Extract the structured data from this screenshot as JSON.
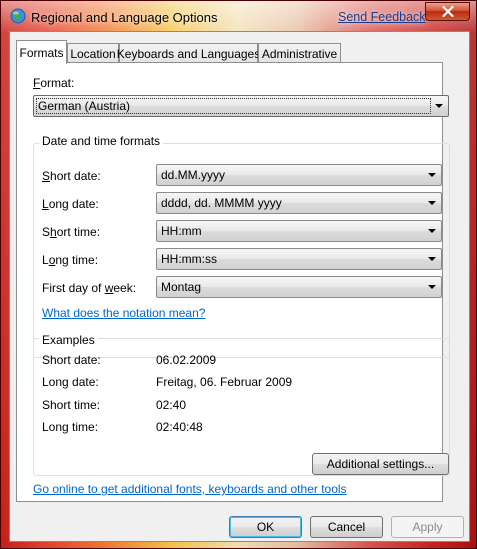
{
  "window": {
    "title": "Regional and Language Options",
    "send_feedback": "Send Feedback",
    "close_icon": "close-icon"
  },
  "tabs": [
    {
      "label": "Formats",
      "active": true
    },
    {
      "label": "Location",
      "active": false
    },
    {
      "label": "Keyboards and Languages",
      "active": false
    },
    {
      "label": "Administrative",
      "active": false
    }
  ],
  "format": {
    "label": "Format:",
    "value": "German (Austria)"
  },
  "date_time": {
    "group_title": "Date and time formats",
    "short_date": {
      "label": "Short date:",
      "value": "dd.MM.yyyy"
    },
    "long_date": {
      "label": "Long date:",
      "value": "dddd, dd. MMMM yyyy"
    },
    "short_time": {
      "label": "Short time:",
      "value": "HH:mm"
    },
    "long_time": {
      "label": "Long time:",
      "value": "HH:mm:ss"
    },
    "first_day": {
      "label": "First day of week:",
      "value": "Montag"
    },
    "notation_link": "What does the notation mean?"
  },
  "examples": {
    "group_title": "Examples",
    "rows": [
      {
        "label": "Short date:",
        "value": "06.02.2009"
      },
      {
        "label": "Long date:",
        "value": "Freitag, 06. Februar 2009"
      },
      {
        "label": "Short time:",
        "value": "02:40"
      },
      {
        "label": "Long time:",
        "value": "02:40:48"
      }
    ]
  },
  "additional_settings": "Additional settings...",
  "online_link": "Go online to get additional fonts, keyboards and other tools",
  "buttons": {
    "ok": "OK",
    "cancel": "Cancel",
    "apply": "Apply"
  }
}
